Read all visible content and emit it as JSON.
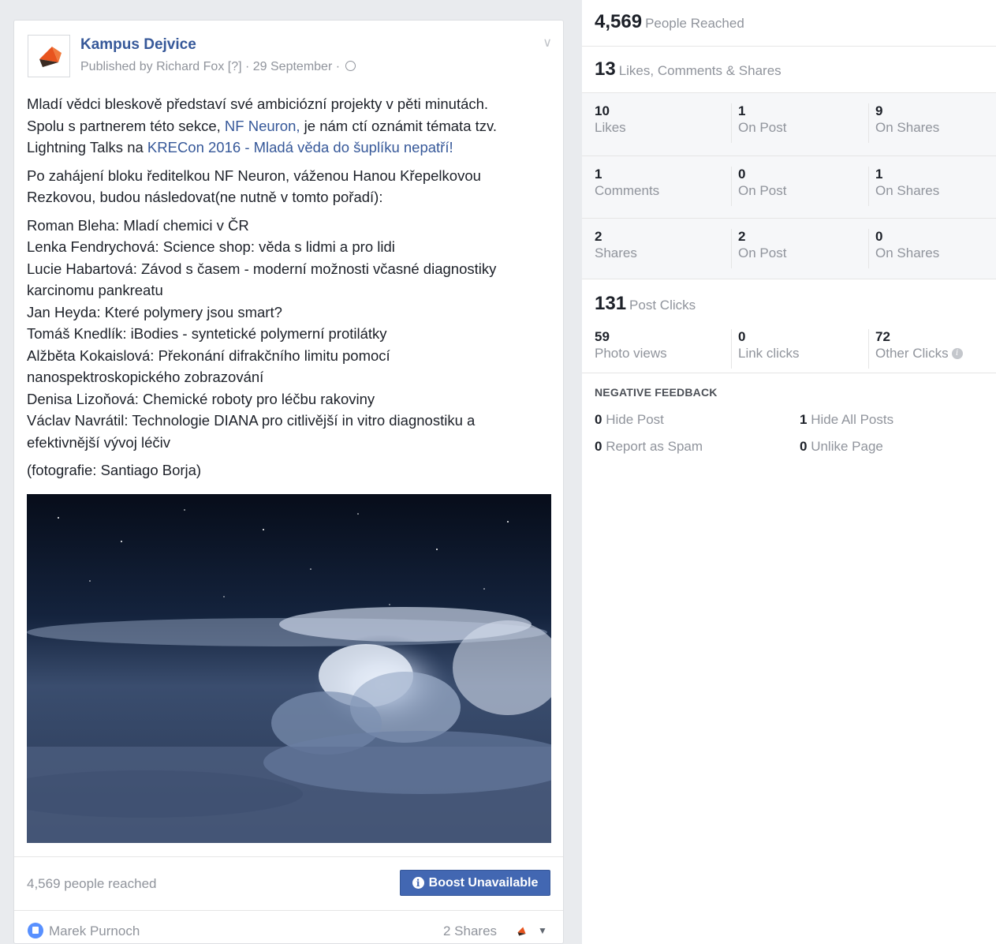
{
  "post": {
    "page_name": "Kampus Dejvice",
    "published_by": "Published by Richard Fox [?] · 29 September ·",
    "paragraph1": {
      "l1": "Mladí vědci bleskově představí své ambiciózní projekty v pěti minutách.",
      "l2_pre": "Spolu s partnerem této sekce, ",
      "l2_link": "NF Neuron,",
      "l2_post": " je nám ctí oznámit témata tzv.",
      "l3_pre": "Lightning Talks na ",
      "l3_link": "KRECon 2016 - Mladá věda do šuplíku nepatří!"
    },
    "paragraph2": [
      "Po zahájení bloku ředitelkou NF Neuron, váženou Hanou Křepelkovou",
      "Rezkovou, budou následovat(ne nutně v tomto pořadí):"
    ],
    "speakers": [
      "Roman Bleha: Mladí chemici v ČR",
      "Lenka Fendrychová: Science shop: věda s lidmi a pro lidi",
      "Lucie Habartová: Závod s časem - moderní možnosti včasné diagnostiky",
      "karcinomu pankreatu",
      "Jan Heyda: Které polymery jsou smart?",
      "Tomáš Knedlík: iBodies - syntetické polymerní protilátky",
      "Alžběta Kokaislová: Překonání difrakčního limitu pomocí",
      "nanospektroskopického zobrazování",
      "Denisa Lizoňová: Chemické roboty pro léčbu rakoviny",
      "Václav Navrátil: Technologie DIANA pro citlivější in vitro diagnostiku a",
      "efektivnější vývoj léčiv"
    ],
    "photo_credit": "(fotografie: Santiago Borja)",
    "reached_text": "4,569 people reached",
    "boost_label": "Boost Unavailable",
    "liker_name": "Marek Purnoch",
    "shares_text": "2 Shares"
  },
  "insights": {
    "reached": {
      "num": "4,569",
      "label": "People Reached"
    },
    "engagement": {
      "num": "13",
      "label": "Likes, Comments & Shares"
    },
    "rows": [
      {
        "c1n": "10",
        "c1l": "Likes",
        "c2n": "1",
        "c2l": "On Post",
        "c3n": "9",
        "c3l": "On Shares"
      },
      {
        "c1n": "1",
        "c1l": "Comments",
        "c2n": "0",
        "c2l": "On Post",
        "c3n": "1",
        "c3l": "On Shares"
      },
      {
        "c1n": "2",
        "c1l": "Shares",
        "c2n": "2",
        "c2l": "On Post",
        "c3n": "0",
        "c3l": "On Shares"
      }
    ],
    "clicks": {
      "num": "131",
      "label": "Post Clicks"
    },
    "click_row": {
      "c1n": "59",
      "c1l": "Photo views",
      "c2n": "0",
      "c2l": "Link clicks",
      "c3n": "72",
      "c3l": "Other Clicks"
    },
    "negative": {
      "title": "NEGATIVE FEEDBACK",
      "hide_post": {
        "n": "0",
        "l": "Hide Post"
      },
      "hide_all": {
        "n": "1",
        "l": "Hide All Posts"
      },
      "spam": {
        "n": "0",
        "l": "Report as Spam"
      },
      "unlike": {
        "n": "0",
        "l": "Unlike Page"
      }
    }
  },
  "colors": {
    "link": "#365899",
    "boost": "#4267b2",
    "logo_orange": "#e8541e"
  }
}
